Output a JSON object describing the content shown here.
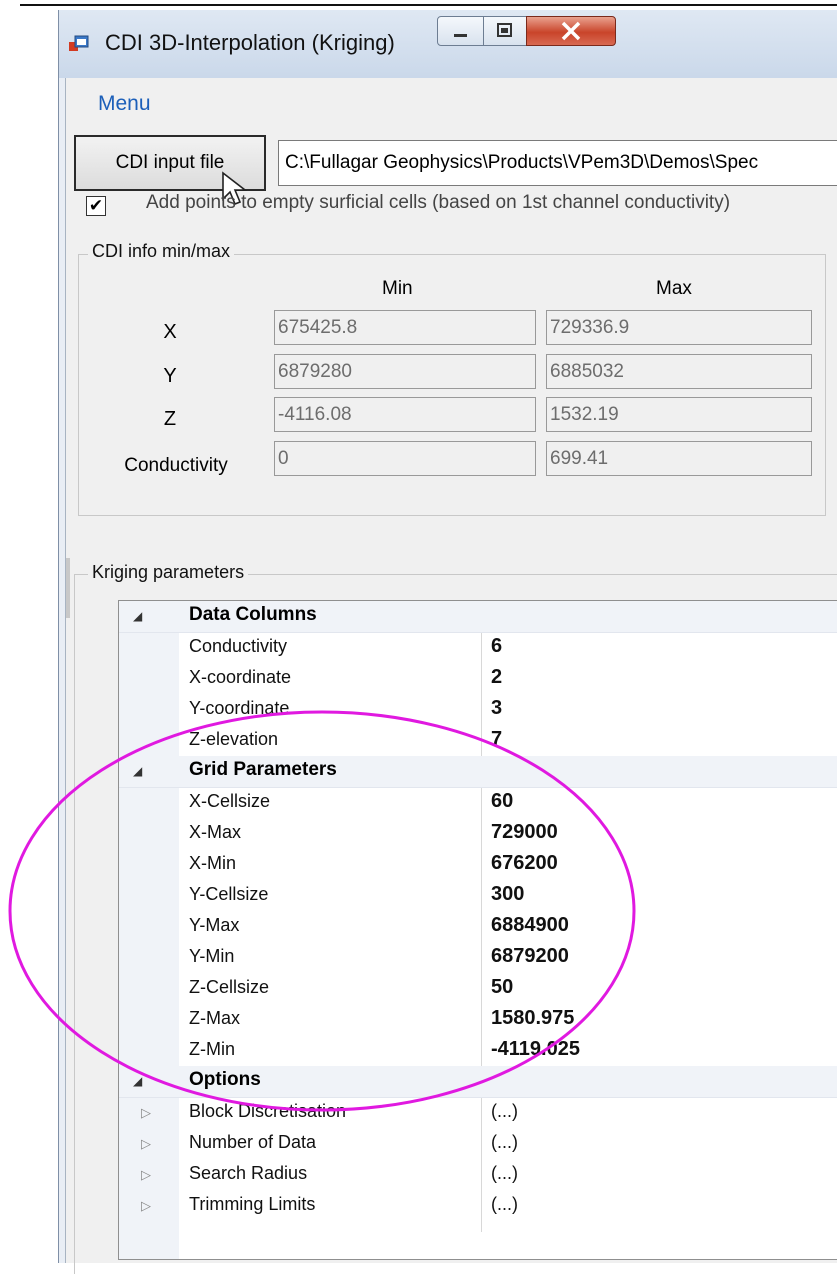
{
  "window": {
    "title": "CDI 3D-Interpolation (Kriging)",
    "buttons": {
      "minimize": "minimize",
      "maximize": "maximize",
      "close": "close"
    }
  },
  "menu": {
    "label": "Menu"
  },
  "input": {
    "button_label": "CDI input file",
    "path_value": "C:\\Fullagar Geophysics\\Products\\VPem3D\\Demos\\Spec"
  },
  "checkbox": {
    "checked": true,
    "label": "Add points to empty surficial cells (based on 1st channel conductivity)"
  },
  "cdi_info": {
    "legend": "CDI info min/max",
    "col_min": "Min",
    "col_max": "Max",
    "rows": [
      {
        "label": "X",
        "min": "675425.8",
        "max": "729336.9"
      },
      {
        "label": "Y",
        "min": "6879280",
        "max": "6885032"
      },
      {
        "label": "Z",
        "min": "-4116.08",
        "max": "1532.19"
      },
      {
        "label": "Conductivity",
        "min": "0",
        "max": "699.41"
      }
    ]
  },
  "kriging": {
    "legend": "Kriging parameters",
    "categories": [
      {
        "name": "Data Columns",
        "props": [
          {
            "name": "Conductivity",
            "value": "6"
          },
          {
            "name": "X-coordinate",
            "value": "2"
          },
          {
            "name": "Y-coordinate",
            "value": "3"
          },
          {
            "name": "Z-elevation",
            "value": "7"
          }
        ]
      },
      {
        "name": "Grid Parameters",
        "props": [
          {
            "name": "X-Cellsize",
            "value": "60"
          },
          {
            "name": "X-Max",
            "value": "729000"
          },
          {
            "name": "X-Min",
            "value": "676200"
          },
          {
            "name": "Y-Cellsize",
            "value": "300"
          },
          {
            "name": "Y-Max",
            "value": "6884900"
          },
          {
            "name": "Y-Min",
            "value": "6879200"
          },
          {
            "name": "Z-Cellsize",
            "value": "50"
          },
          {
            "name": "Z-Max",
            "value": "1580.975"
          },
          {
            "name": "Z-Min",
            "value": "-4119.025"
          }
        ]
      },
      {
        "name": "Options",
        "props": [
          {
            "name": "Block Discretisation",
            "value": "(...)"
          },
          {
            "name": "Number of Data",
            "value": "(...)"
          },
          {
            "name": "Search Radius",
            "value": "(...)"
          },
          {
            "name": "Trimming Limits",
            "value": "(...)"
          }
        ]
      }
    ]
  },
  "colors": {
    "menu_link": "#1c5fb9",
    "highlight_ellipse": "#e019e0",
    "close_button": "#c9442a"
  },
  "icons": {
    "app": "app-window-icon",
    "cursor": "mouse-pointer-icon",
    "collapse": "triangle-collapse-icon",
    "expand": "triangle-expand-icon"
  }
}
